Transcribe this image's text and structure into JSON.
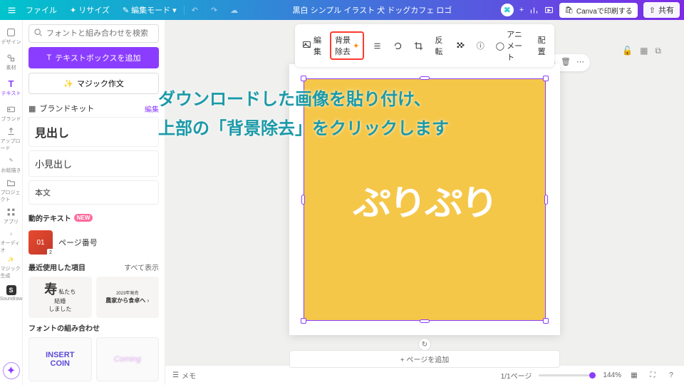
{
  "topbar": {
    "file": "ファイル",
    "resize": "リサイズ",
    "edit_mode": "編集モード",
    "title": "黒白 シンプル イラスト 犬 ドッグカフェ ロゴ",
    "print": "Canvaで印刷する",
    "share": "共有"
  },
  "rail": {
    "design": "デザイン",
    "elements": "素材",
    "text": "テキスト",
    "brand": "ブランド",
    "upload": "アップロード",
    "draw": "お絵描き",
    "project": "プロジェクト",
    "apps": "アプリ",
    "audio": "オーディオ",
    "magic": "マジック生成",
    "soundraw": "Soundraw"
  },
  "panel": {
    "search_placeholder": "フォントと組み合わせを検索",
    "add_textbox": "テキストボックスを追加",
    "magic_write": "マジック作文",
    "brand_kit": "ブランドキット",
    "edit": "編集",
    "heading": "見出し",
    "subheading": "小見出し",
    "body": "本文",
    "dynamic_text": "動的テキスト",
    "new_badge": "NEW",
    "page_number": "ページ番号",
    "page_number_badge": "2",
    "recent": "最近使用した項目",
    "show_all": "すべて表示",
    "recent1_line1": "私たち",
    "recent1_line2": "結婚",
    "recent1_line3": "しました",
    "recent1_kanji": "寿",
    "recent2_top": "2023年発売",
    "recent2_main": "農家から食卓へ",
    "font_combo": "フォントの組み合わせ",
    "combo1_line1": "INSERT",
    "combo1_line2": "COIN"
  },
  "ctx": {
    "edit": "編集",
    "bgremove": "背景除去",
    "flip": "反転",
    "animate": "アニメート",
    "position": "配置"
  },
  "canvas": {
    "text": "ぷりぷり",
    "add_page": "+ ページを追加"
  },
  "bottom": {
    "memo": "メモ",
    "pages": "1/1ページ",
    "zoom": "144%"
  },
  "instruction": {
    "line1": "ダウンロードした画像を貼り付け、",
    "line2": "上部の「背景除去」をクリックします"
  }
}
